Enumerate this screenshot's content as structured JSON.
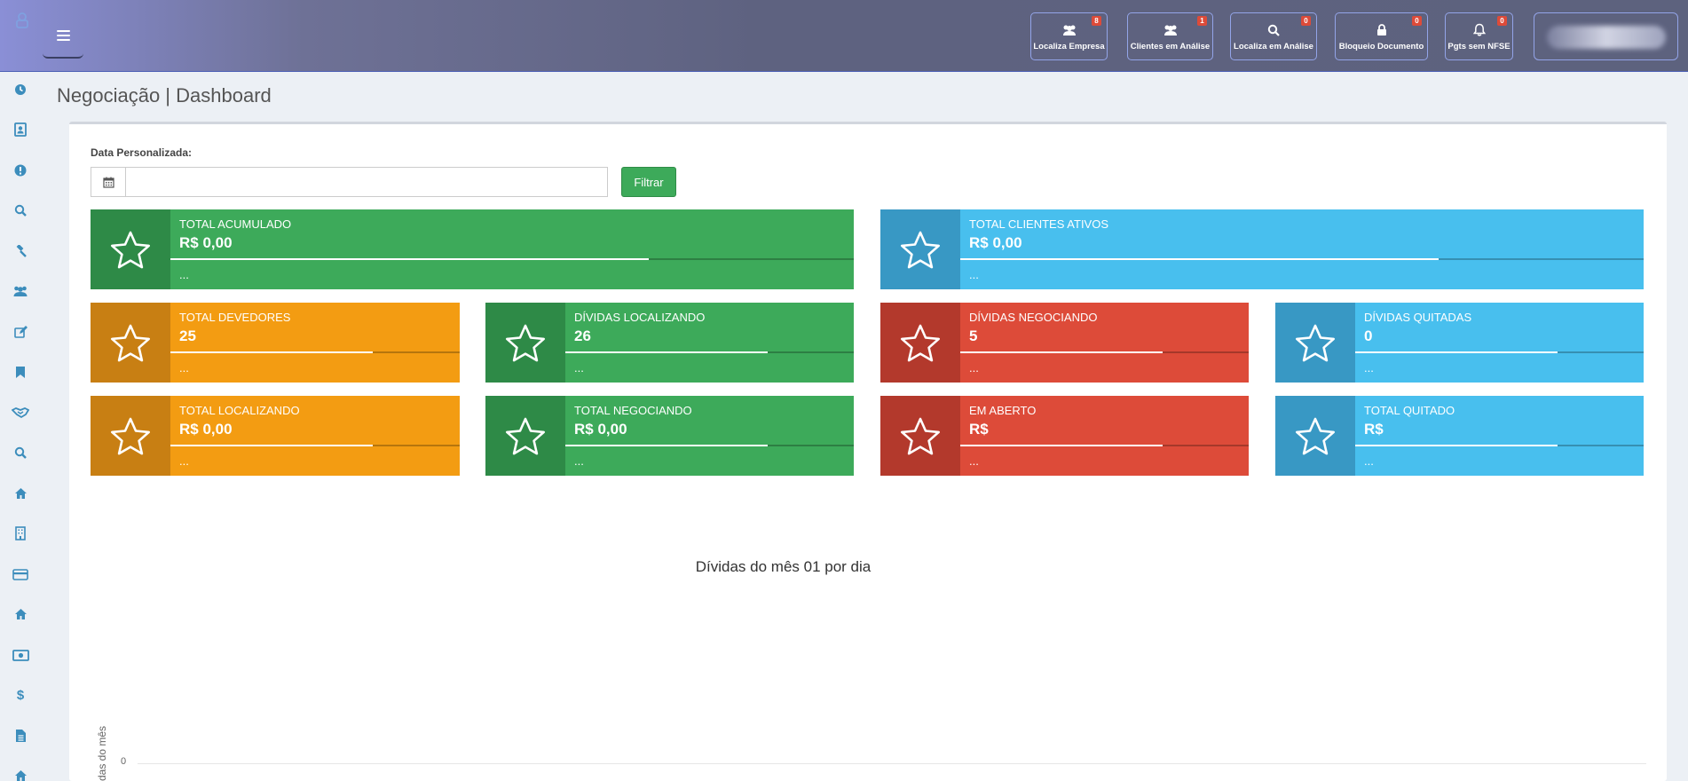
{
  "header": {
    "buttons": [
      {
        "label": "Localiza Empresa",
        "badge": "8",
        "icon": "users-icon"
      },
      {
        "label": "Clientes em Análise",
        "badge": "1",
        "icon": "users-icon"
      },
      {
        "label": "Localiza em Análise",
        "badge": "0",
        "icon": "search-icon"
      },
      {
        "label": "Bloqueio Documento",
        "badge": "0",
        "icon": "lock-icon"
      },
      {
        "label": "Pgts sem NFSE",
        "badge": "0",
        "icon": "bell-icon"
      }
    ]
  },
  "sidebar": {
    "items": [
      {
        "icon": "dashboard-icon"
      },
      {
        "icon": "contact-card-icon"
      },
      {
        "icon": "alert-icon"
      },
      {
        "icon": "search-icon"
      },
      {
        "icon": "gavel-icon"
      },
      {
        "icon": "users-icon"
      },
      {
        "icon": "edit-icon"
      },
      {
        "icon": "bookmark-icon"
      },
      {
        "icon": "handshake-icon"
      },
      {
        "icon": "search-icon"
      },
      {
        "icon": "home-icon"
      },
      {
        "icon": "building-icon"
      },
      {
        "icon": "credit-card-icon"
      },
      {
        "icon": "home-icon"
      },
      {
        "icon": "money-icon"
      },
      {
        "icon": "dollar-icon"
      },
      {
        "icon": "file-icon"
      },
      {
        "icon": "home-icon"
      }
    ]
  },
  "page": {
    "title": "Negociação | Dashboard"
  },
  "filter": {
    "label": "Data Personalizada:",
    "value": "",
    "button_label": "Filtrar"
  },
  "cards": {
    "total_acumulado": {
      "title": "TOTAL ACUMULADO",
      "value": "R$ 0,00",
      "desc": "...",
      "progress": 0.7
    },
    "total_clientes_ativos": {
      "title": "TOTAL CLIENTES ATIVOS",
      "value": "R$ 0,00",
      "desc": "...",
      "progress": 0.7
    },
    "total_devedores": {
      "title": "TOTAL DEVEDORES",
      "value": "25",
      "desc": "...",
      "progress": 0.7
    },
    "dividas_localizando": {
      "title": "DÍVIDAS LOCALIZANDO",
      "value": "26",
      "desc": "...",
      "progress": 0.7
    },
    "dividas_negociando": {
      "title": "DÍVIDAS NEGOCIANDO",
      "value": "5",
      "desc": "...",
      "progress": 0.7
    },
    "dividas_quitadas": {
      "title": "DÍVIDAS QUITADAS",
      "value": "0",
      "desc": "...",
      "progress": 0.7
    },
    "total_localizando": {
      "title": "TOTAL LOCALIZANDO",
      "value": "R$ 0,00",
      "desc": "...",
      "progress": 0.7
    },
    "total_negociando": {
      "title": "TOTAL NEGOCIANDO",
      "value": "R$ 0,00",
      "desc": "...",
      "progress": 0.7
    },
    "em_aberto": {
      "title": "EM ABERTO",
      "value": "R$",
      "desc": "...",
      "progress": 0.7
    },
    "total_quitado": {
      "title": "TOTAL QUITADO",
      "value": "R$",
      "desc": "...",
      "progress": 0.7
    }
  },
  "chart": {
    "title": "Dívidas do mês 01 por dia",
    "ylabel": "das do mês",
    "y_tick": "0"
  },
  "colors": {
    "green": "#3daa5a",
    "aqua": "#48bfee",
    "yellow": "#f39c12",
    "red": "#dd4b39",
    "sidebar_icon": "#3c8dbc"
  }
}
